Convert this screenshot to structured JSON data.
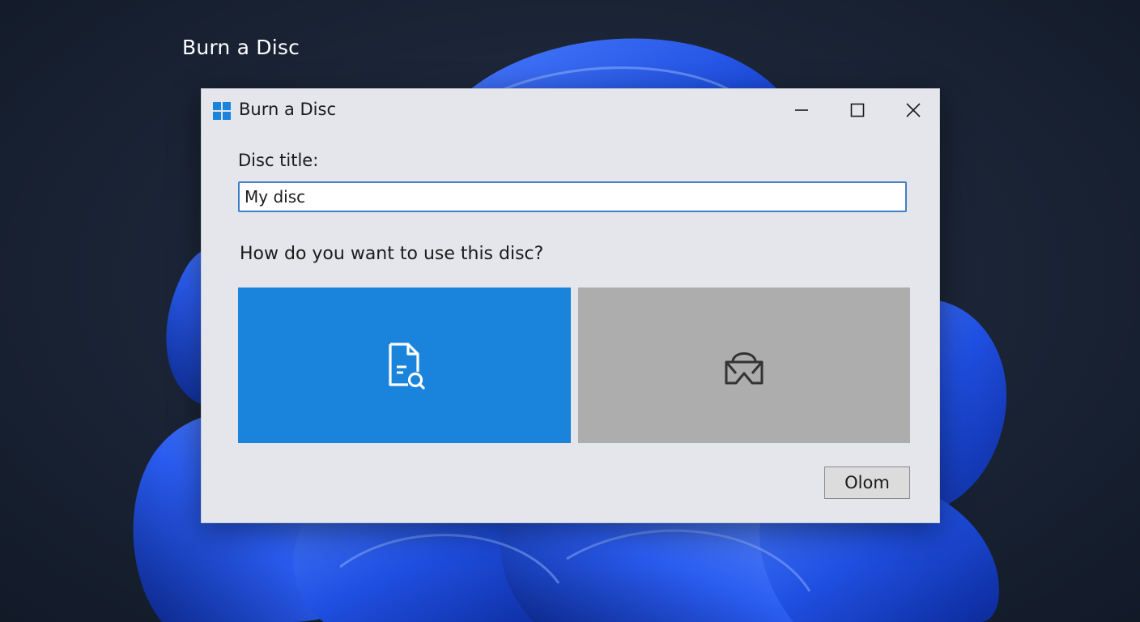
{
  "desktop": {
    "title": "Burn a Disc"
  },
  "dialog": {
    "title": "Burn a Disc",
    "app_icon": "windows-logo-icon",
    "controls": {
      "minimize_icon": "minimize-icon",
      "maximize_icon": "maximize-icon",
      "close_icon": "close-icon"
    },
    "disc_title_label": "Disc title:",
    "disc_title_value": "My disc",
    "question": "How do you want to use this disc?",
    "options": [
      {
        "icon": "document-search-icon",
        "selected": true,
        "color": "#1a84dc"
      },
      {
        "icon": "disc-player-icon",
        "selected": false,
        "color": "#adadad"
      }
    ],
    "action_button_label": "Olom"
  },
  "colors": {
    "accent": "#1a84dc",
    "dialog_background": "#e4e6ec",
    "input_border": "#3f7fc4"
  }
}
